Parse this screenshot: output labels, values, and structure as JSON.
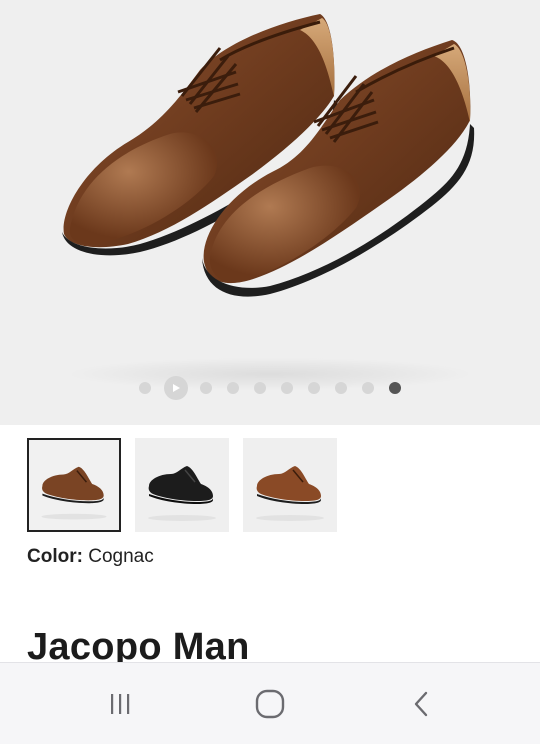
{
  "gallery": {
    "slides": [
      "video",
      "image",
      "image",
      "image",
      "image",
      "image",
      "image",
      "image",
      "image",
      "image"
    ],
    "active_slide_index": 9,
    "play_icon": "play-icon"
  },
  "thumbnails": [
    {
      "variant": "cognac",
      "shoe_color": "#7a4424",
      "selected": true
    },
    {
      "variant": "black",
      "shoe_color": "#1c1c1c",
      "selected": false
    },
    {
      "variant": "brown",
      "shoe_color": "#8a4a26",
      "selected": false
    }
  ],
  "color": {
    "label": "Color:",
    "value": "Cognac"
  },
  "product": {
    "name": "Jacopo Man"
  },
  "system_nav": {
    "recents_icon": "recents-icon",
    "home_icon": "home-icon",
    "back_icon": "back-icon"
  },
  "colors": {
    "hero_bg": "#efefef",
    "dot_inactive": "#d6d6d6",
    "dot_active": "#555555",
    "shoe_leather": "#7a4424"
  }
}
